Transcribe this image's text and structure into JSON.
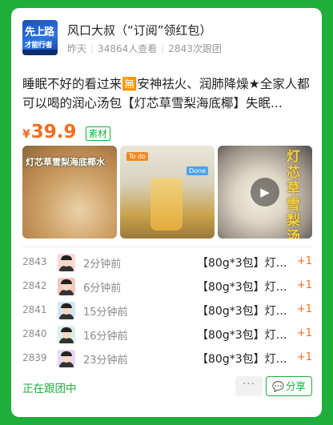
{
  "account": {
    "avatar_text_1": "先上路",
    "avatar_text_2": "才能行者",
    "name": "风口大叔（“订阅”领红包）",
    "time": "昨天",
    "views": "34864人查看",
    "follows": "2843次跟团"
  },
  "post": {
    "title": "睡眠不好的看过来🈚安神祛火、润肺降燥★全家人都可以喝的润心汤包【灯芯草雪梨海底椰】失眠...",
    "price_currency": "¥",
    "price_value": "39.9",
    "tag": "素材",
    "images": [
      {
        "caption": "灯芯草雪梨海底椰水",
        "icon": "product-photo"
      },
      {
        "caption": "",
        "badge_todo": "To do",
        "badge_done": "Done",
        "icon": "drink-photo"
      },
      {
        "caption": "灯芯草雪梨汤",
        "icon": "soup-video",
        "play_icon": "▶"
      }
    ]
  },
  "orders": [
    {
      "rank": "2843",
      "time_ago": "2分钟前",
      "item": "【80g*3包】灯芯...",
      "qty": "+1",
      "avatar_bg": "#ffd7d7"
    },
    {
      "rank": "2842",
      "time_ago": "6分钟前",
      "item": "【80g*3包】灯芯...",
      "qty": "+1",
      "avatar_bg": "#f6c8c0"
    },
    {
      "rank": "2841",
      "time_ago": "15分钟前",
      "item": "【80g*3包】灯芯...",
      "qty": "+1",
      "avatar_bg": "#cfe6f7"
    },
    {
      "rank": "2840",
      "time_ago": "16分钟前",
      "item": "【80g*3包】灯芯...",
      "qty": "+1",
      "avatar_bg": "#d8f1ec"
    },
    {
      "rank": "2839",
      "time_ago": "23分钟前",
      "item": "【80g*3包】灯芯...",
      "qty": "+1",
      "avatar_bg": "#e6d9f5"
    }
  ],
  "footer": {
    "status": "正在跟团中",
    "more_label": "···",
    "share_label": "分享",
    "share_icon": "wechat-icon"
  },
  "colors": {
    "brand_green": "#1fae3c",
    "price_orange": "#f26d20"
  }
}
